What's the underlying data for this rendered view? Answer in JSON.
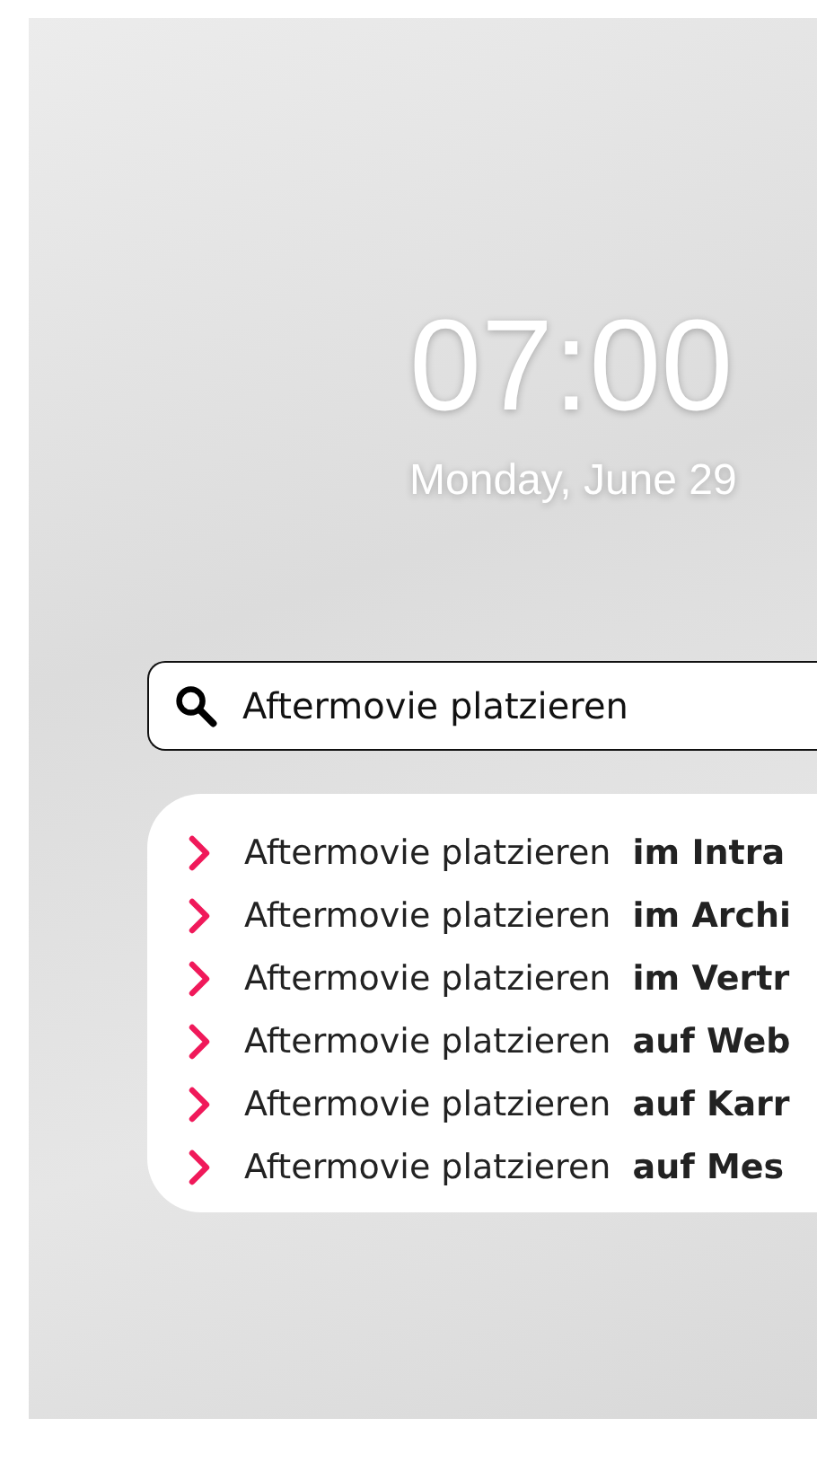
{
  "clock": {
    "time": "07:00",
    "date": "Monday, June 29"
  },
  "search": {
    "value": "Aftermovie platzieren"
  },
  "suggestions": [
    {
      "text": "Aftermovie platzieren  **im Intra**"
    },
    {
      "text": "Aftermovie platzieren  **im Archi**"
    },
    {
      "text": "Aftermovie platzieren  **im Vertr**"
    },
    {
      "text": "Aftermovie platzieren  **auf Web**"
    },
    {
      "text": "Aftermovie platzieren  **auf Karr**"
    },
    {
      "text": "Aftermovie platzieren  **auf Mes**"
    }
  ]
}
